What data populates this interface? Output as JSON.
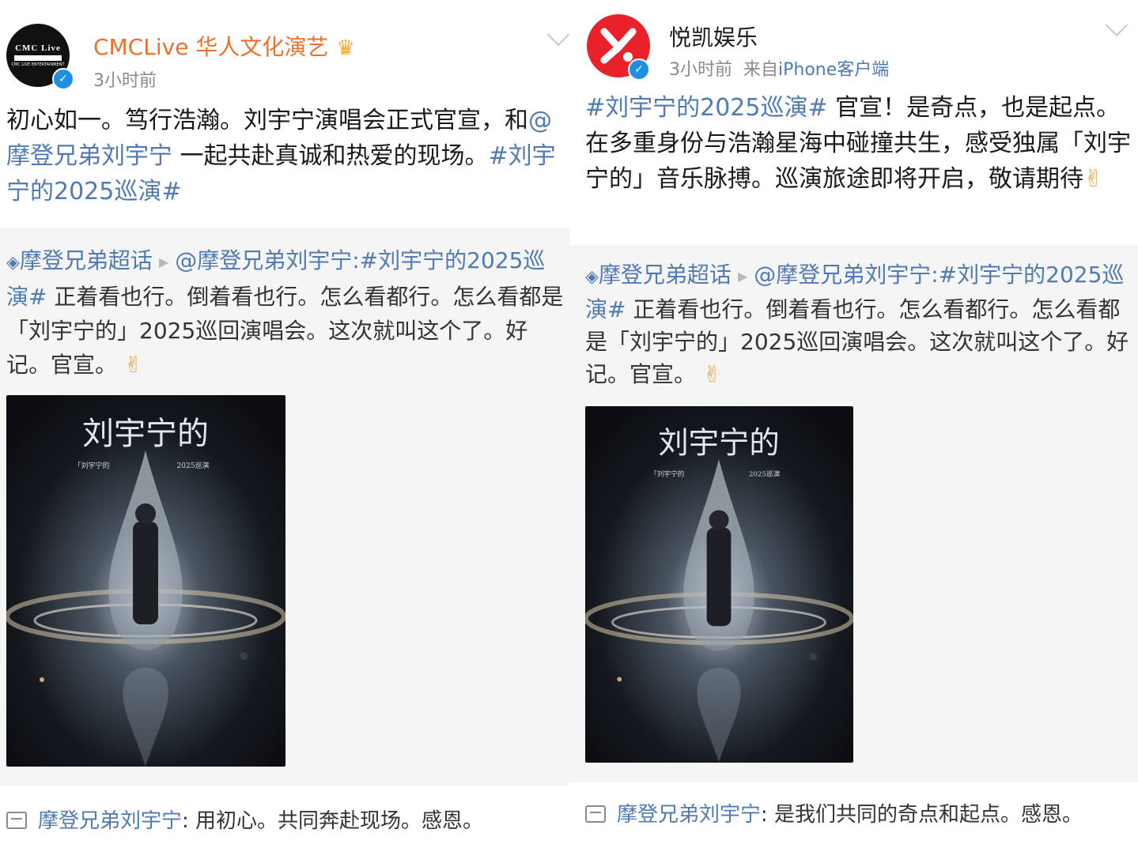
{
  "left": {
    "account_name": "CMCLive 华人文化演艺",
    "badge_icon": "crown-level-badge-icon",
    "avatar_text": "CMC Live",
    "avatar_subtext": "CMC LIVE ENTERTAINMENT",
    "time": "3小时前",
    "post_parts": [
      "初心如一。笃行浩瀚。刘宇宁演唱会正式官宣，和",
      "@摩登兄弟刘宇宁",
      " 一起共赴真诚和热爱的现场。",
      "#刘宇宁的2025巡演#"
    ],
    "quote": {
      "icon_label": "◈",
      "topic": "摩登兄弟超话",
      "mention_tag": "@摩登兄弟刘宇宁:#刘宇宁的2025巡演#",
      "text": " 正着看也行。倒着看也行。怎么看都行。怎么看都是「刘宇宁的」2025巡回演唱会。这次就叫这个了。好记。官宣。",
      "emoji": "✌"
    },
    "poster": {
      "title": "刘宇宁的",
      "sub_left": "「刘宇宁的",
      "sub_right": "2025巡演"
    },
    "comment": {
      "author": "摩登兄弟刘宇宁",
      "text": ": 用初心。共同奔赴现场。感恩。"
    }
  },
  "right": {
    "account_name": "悦凯娱乐",
    "time": "3小时前",
    "source_prefix": "来自",
    "source_device": "iPhone客户端",
    "post_parts": [
      "#刘宇宁的2025巡演#",
      " 官宣！是奇点，也是起点。在多重身份与浩瀚星海中碰撞共生，感受独属「刘宇宁的」音乐脉搏。巡演旅途即将开启，敬请期待",
      "✌"
    ],
    "quote": {
      "icon_label": "◈",
      "topic": "摩登兄弟超话",
      "mention_tag": "@摩登兄弟刘宇宁:#刘宇宁的2025巡演#",
      "text": " 正着看也行。倒着看也行。怎么看都行。怎么看都是「刘宇宁的」2025巡回演唱会。这次就叫这个了。好记。官宣。",
      "emoji": "✌"
    },
    "poster": {
      "title": "刘宇宁的",
      "sub_left": "「刘宇宁的",
      "sub_right": "2025巡演"
    },
    "comment": {
      "author": "摩登兄弟刘宇宁",
      "text": ": 是我们共同的奇点和起点。感恩。"
    }
  },
  "colors": {
    "link_blue": "#4f7ab3",
    "name_orange": "#f07028",
    "verified_blue": "#1e8fe1",
    "quote_bg": "#f5f5f5",
    "brand_red": "#e8212b"
  }
}
